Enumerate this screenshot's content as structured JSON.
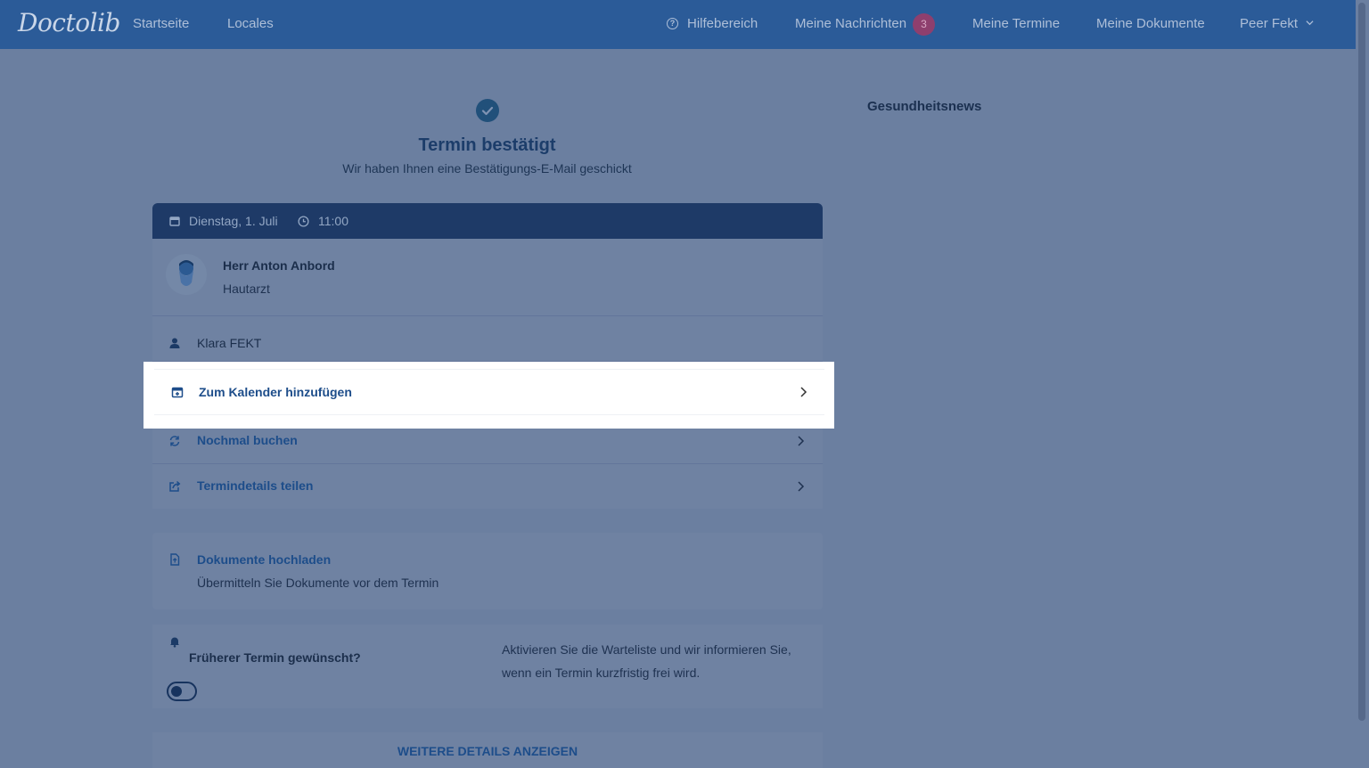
{
  "nav": {
    "logo": "Doctolib",
    "home": "Startseite",
    "locales": "Locales",
    "help": "Hilfebereich",
    "messages": "Meine Nachrichten",
    "messages_count": "3",
    "appointments": "Meine Termine",
    "documents": "Meine Dokumente",
    "user": "Peer Fekt"
  },
  "confirmation": {
    "title": "Termin bestätigt",
    "subtitle": "Wir haben Ihnen eine Bestätigungs-E-Mail geschickt"
  },
  "sidebar": {
    "title": "Gesundheitsnews"
  },
  "appointment": {
    "date": "Dienstag, 1. Juli",
    "time": "11:00",
    "doctor_name": "Herr Anton Anbord",
    "doctor_specialty": "Hautarzt",
    "patient": "Klara FEKT"
  },
  "actions": {
    "add_calendar": "Zum Kalender hinzufügen",
    "rebook": "Nochmal buchen",
    "share": "Termindetails teilen"
  },
  "documents": {
    "title": "Dokumente hochladen",
    "subtitle": "Übermitteln Sie Dokumente vor dem Termin"
  },
  "waitlist": {
    "title": "Früherer Termin gewünscht?",
    "description": "Aktivieren Sie die Warteliste und wir informieren Sie, wenn ein Termin kurzfristig frei wird.",
    "enabled": false
  },
  "more": {
    "label": "WEITERE DETAILS ANZEIGEN"
  },
  "colors": {
    "nav_bg": "#2b5b98",
    "overlay_bg": "#6b7fa0",
    "link": "#1d4d8a",
    "highlight": "#ffffff"
  }
}
